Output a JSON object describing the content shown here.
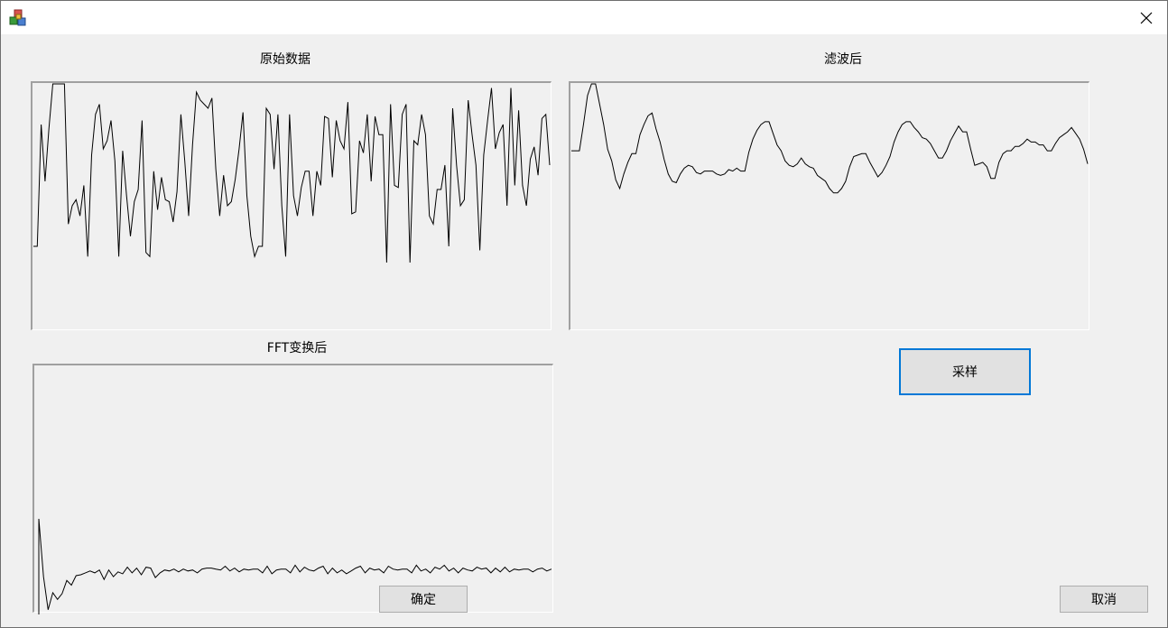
{
  "window": {
    "title": "",
    "icon": "app-cubes-icon",
    "close_icon": "close-icon"
  },
  "labels": {
    "raw": "原始数据",
    "filtered": "滤波后",
    "fft": "FFT变换后"
  },
  "buttons": {
    "sample": "采样",
    "ok": "确定",
    "cancel": "取消"
  },
  "colors": {
    "line": "#000000",
    "focus": "#0078d7"
  },
  "chart_data": [
    {
      "type": "line",
      "title": "原始数据",
      "ylim": [
        0,
        100
      ],
      "values": [
        20,
        20,
        80,
        52,
        78,
        100,
        100,
        100,
        100,
        31,
        40,
        43,
        35,
        50,
        15,
        65,
        85,
        90,
        68,
        72,
        82,
        62,
        15,
        67,
        45,
        25,
        42,
        48,
        82,
        17,
        15,
        57,
        38,
        54,
        43,
        42,
        32,
        47,
        85,
        62,
        35,
        70,
        96,
        92,
        90,
        88,
        93,
        58,
        35,
        55,
        40,
        42,
        53,
        68,
        86,
        45,
        25,
        15,
        20,
        20,
        88,
        85,
        58,
        85,
        40,
        15,
        85,
        45,
        35,
        49,
        57,
        57,
        35,
        57,
        50,
        84,
        83,
        54,
        82,
        72,
        68,
        91,
        36,
        37,
        72,
        66,
        85,
        52,
        84,
        75,
        75,
        12,
        90,
        50,
        49,
        85,
        90,
        12,
        72,
        70,
        85,
        75,
        35,
        31,
        48,
        48,
        60,
        20,
        88,
        60,
        40,
        43,
        92,
        75,
        60,
        18,
        65,
        82,
        98,
        68,
        76,
        80,
        40,
        98,
        50,
        87,
        50,
        40,
        63,
        69,
        55,
        83,
        85,
        60
      ],
      "grid": false,
      "legend": "none"
    },
    {
      "type": "line",
      "title": "滤波后",
      "ylim": [
        0,
        100
      ],
      "values": [
        54,
        54,
        54,
        72,
        92,
        100,
        100,
        86,
        72,
        55,
        47,
        34,
        28,
        38,
        46,
        52,
        52,
        65,
        72,
        78,
        80,
        69,
        60,
        48,
        38,
        33,
        32,
        38,
        42,
        44,
        43,
        39,
        38,
        40,
        40,
        40,
        38,
        37,
        38,
        41,
        40,
        42,
        40,
        40,
        53,
        62,
        68,
        72,
        74,
        74,
        66,
        58,
        54,
        47,
        44,
        43,
        45,
        49,
        45,
        43,
        42,
        37,
        35,
        33,
        28,
        25,
        25,
        28,
        33,
        43,
        50,
        51,
        52,
        52,
        46,
        41,
        36,
        39,
        44,
        50,
        60,
        67,
        72,
        74,
        74,
        70,
        67,
        63,
        62,
        59,
        54,
        49,
        49,
        54,
        61,
        66,
        71,
        67,
        67,
        55,
        44,
        45,
        46,
        43,
        35,
        35,
        46,
        52,
        54,
        54,
        57,
        57,
        59,
        62,
        60,
        60,
        58,
        58,
        54,
        54,
        59,
        63,
        65,
        67,
        70,
        66,
        62,
        55,
        45
      ],
      "grid": false,
      "legend": "none"
    },
    {
      "type": "line",
      "title": "FFT变换后",
      "ylim": [
        0,
        100
      ],
      "values": [
        100,
        39,
        4,
        22,
        15,
        21,
        35,
        30,
        40,
        41,
        43,
        45,
        43,
        46,
        36,
        46,
        39,
        44,
        42,
        49,
        43,
        48,
        41,
        49,
        48,
        38,
        43,
        46,
        45,
        47,
        44,
        47,
        45,
        46,
        43,
        47,
        48,
        48,
        47,
        46,
        50,
        45,
        48,
        44,
        47,
        46,
        47,
        47,
        43,
        50,
        42,
        46,
        47,
        47,
        43,
        51,
        44,
        49,
        46,
        45,
        48,
        50,
        42,
        48,
        43,
        46,
        42,
        45,
        48,
        50,
        43,
        48,
        46,
        47,
        43,
        50,
        47,
        46,
        47,
        47,
        43,
        51,
        45,
        47,
        43,
        49,
        47,
        51,
        45,
        48,
        43,
        48,
        46,
        45,
        49,
        47,
        48,
        43,
        48,
        44,
        49,
        44,
        47,
        46,
        47,
        47,
        44,
        47,
        48,
        45,
        47
      ]
    }
  ]
}
